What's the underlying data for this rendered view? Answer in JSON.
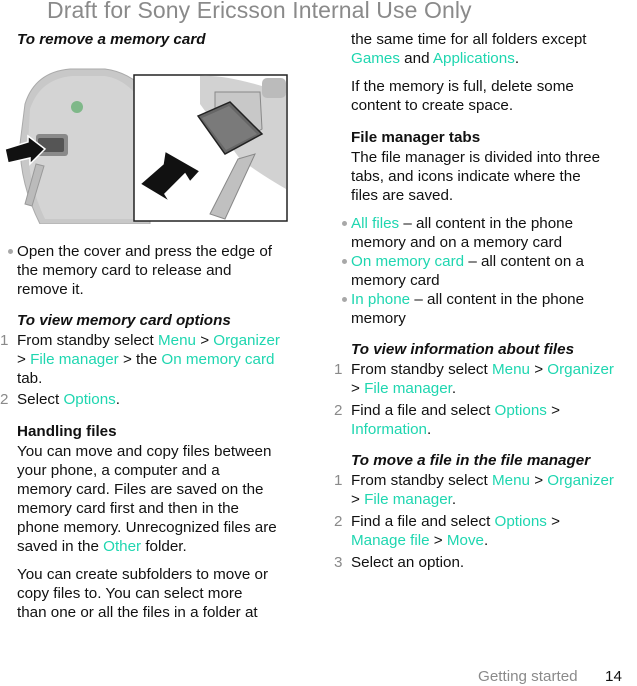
{
  "watermark": "Draft for Sony Ericsson Internal Use Only",
  "left": {
    "remove_heading": "To remove a memory card",
    "illustration_alt": "memory-card-removal-illustration",
    "remove_bullet": [
      "Open the cover and press the edge of",
      "the memory card to release and",
      "remove it."
    ],
    "view_options_heading": "To view memory card options",
    "view_options_steps": [
      {
        "num": "1",
        "lines": [
          [
            {
              "t": "From standby select "
            },
            {
              "t": "Menu",
              "link": true
            },
            {
              "t": " > "
            },
            {
              "t": "Organizer",
              "link": true
            }
          ],
          [
            {
              "t": "> "
            },
            {
              "t": "File manager",
              "link": true
            },
            {
              "t": " > the "
            },
            {
              "t": "On memory card",
              "link": true
            }
          ],
          [
            {
              "t": "tab."
            }
          ]
        ]
      },
      {
        "num": "2",
        "lines": [
          [
            {
              "t": "Select "
            },
            {
              "t": "Options",
              "link": true
            },
            {
              "t": "."
            }
          ]
        ]
      }
    ],
    "handling_heading": "Handling files",
    "handling_para1": [
      [
        {
          "t": "You can move and copy files between"
        }
      ],
      [
        {
          "t": "your phone, a computer and a"
        }
      ],
      [
        {
          "t": "memory card. Files are saved on the"
        }
      ],
      [
        {
          "t": "memory card first and then in the"
        }
      ],
      [
        {
          "t": "phone memory. Unrecognized files are"
        }
      ],
      [
        {
          "t": "saved in the "
        },
        {
          "t": "Other",
          "link": true
        },
        {
          "t": " folder."
        }
      ]
    ],
    "handling_para2": [
      [
        {
          "t": "You can create subfolders to move or"
        }
      ],
      [
        {
          "t": "copy files to. You can select more"
        }
      ],
      [
        {
          "t": "than one or all the files in a folder at"
        }
      ]
    ]
  },
  "right": {
    "para_cont": [
      [
        {
          "t": "the same time for all folders except"
        }
      ],
      [
        {
          "t": "Games",
          "link": true
        },
        {
          "t": " and "
        },
        {
          "t": "Applications",
          "link": true
        },
        {
          "t": "."
        }
      ]
    ],
    "para_full": [
      [
        {
          "t": "If the memory is full, delete some"
        }
      ],
      [
        {
          "t": "content to create space."
        }
      ]
    ],
    "tabs_heading": "File manager tabs",
    "tabs_para": [
      [
        {
          "t": "The file manager is divided into three"
        }
      ],
      [
        {
          "t": "tabs, and icons indicate where the"
        }
      ],
      [
        {
          "t": "files are saved."
        }
      ]
    ],
    "tabs_bullets": [
      {
        "lines": [
          [
            {
              "t": "All files",
              "link": true
            },
            {
              "t": " – all content in the phone"
            }
          ],
          [
            {
              "t": "memory and on a memory card"
            }
          ]
        ]
      },
      {
        "lines": [
          [
            {
              "t": "On memory card",
              "link": true
            },
            {
              "t": " – all content on a"
            }
          ],
          [
            {
              "t": "memory card"
            }
          ]
        ]
      },
      {
        "lines": [
          [
            {
              "t": "In phone",
              "link": true
            },
            {
              "t": " – all content in the phone"
            }
          ],
          [
            {
              "t": "memory"
            }
          ]
        ]
      }
    ],
    "info_heading": "To view information about files",
    "info_steps": [
      {
        "num": "1",
        "lines": [
          [
            {
              "t": "From standby select "
            },
            {
              "t": "Menu",
              "link": true
            },
            {
              "t": " > "
            },
            {
              "t": "Organizer",
              "link": true
            }
          ],
          [
            {
              "t": "> "
            },
            {
              "t": "File manager",
              "link": true
            },
            {
              "t": "."
            }
          ]
        ]
      },
      {
        "num": "2",
        "lines": [
          [
            {
              "t": "Find a file and select "
            },
            {
              "t": "Options",
              "link": true
            },
            {
              "t": " >"
            }
          ],
          [
            {
              "t": "Information",
              "link": true
            },
            {
              "t": "."
            }
          ]
        ]
      }
    ],
    "move_heading": "To move a file in the file manager",
    "move_steps": [
      {
        "num": "1",
        "lines": [
          [
            {
              "t": "From standby select "
            },
            {
              "t": "Menu",
              "link": true
            },
            {
              "t": " > "
            },
            {
              "t": "Organizer",
              "link": true
            }
          ],
          [
            {
              "t": "> "
            },
            {
              "t": "File manager",
              "link": true
            },
            {
              "t": "."
            }
          ]
        ]
      },
      {
        "num": "2",
        "lines": [
          [
            {
              "t": "Find a file and select "
            },
            {
              "t": "Options",
              "link": true
            },
            {
              "t": " >"
            }
          ],
          [
            {
              "t": "Manage file",
              "link": true
            },
            {
              "t": " > "
            },
            {
              "t": "Move",
              "link": true
            },
            {
              "t": "."
            }
          ]
        ]
      },
      {
        "num": "3",
        "lines": [
          [
            {
              "t": "Select an option."
            }
          ]
        ]
      }
    ]
  },
  "footer": {
    "section": "Getting started",
    "page": "14"
  }
}
